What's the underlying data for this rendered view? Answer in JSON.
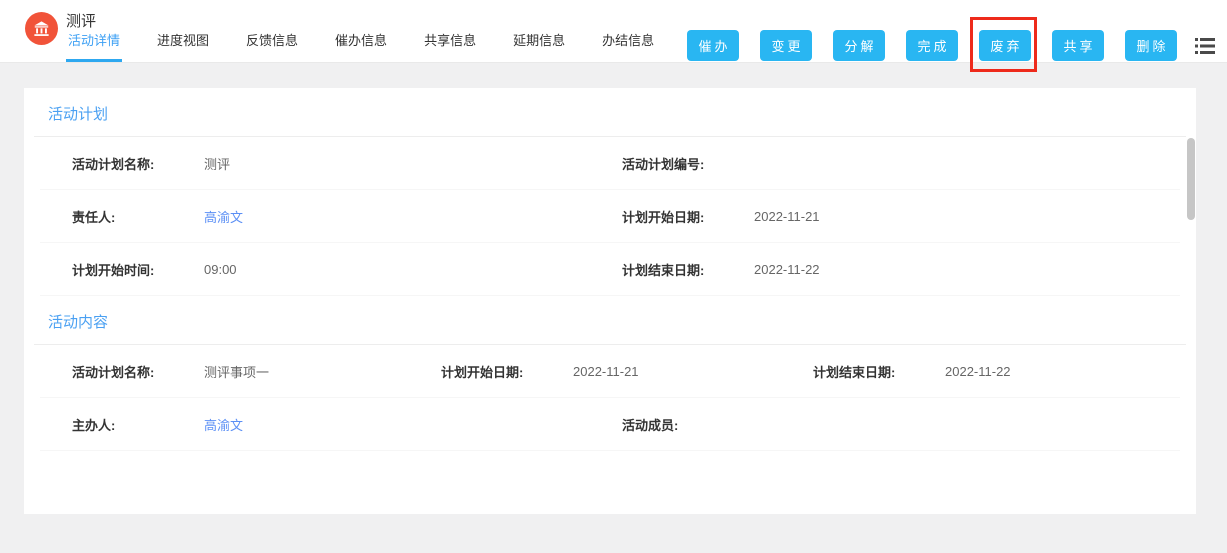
{
  "colors": {
    "button_accent": "#29b6f2",
    "tab_active": "#3da0f4",
    "section_title": "#4aa0f2",
    "person_link": "#5b8ff5",
    "logo_background": "#f15339",
    "annotation_red": "#ee2a1b"
  },
  "header": {
    "title": "测评",
    "tabs": [
      {
        "label": "活动详情",
        "active": true
      },
      {
        "label": "进度视图",
        "active": false
      },
      {
        "label": "反馈信息",
        "active": false
      },
      {
        "label": "催办信息",
        "active": false
      },
      {
        "label": "共享信息",
        "active": false
      },
      {
        "label": "延期信息",
        "active": false
      },
      {
        "label": "办结信息",
        "active": false
      }
    ],
    "actions": [
      {
        "label": "催办"
      },
      {
        "label": "变更"
      },
      {
        "label": "分解"
      },
      {
        "label": "完成"
      },
      {
        "label": "废弃",
        "annotated": true
      },
      {
        "label": "共享"
      },
      {
        "label": "删除"
      }
    ]
  },
  "sections": [
    {
      "title": "活动计划",
      "rows": [
        [
          {
            "label": "活动计划名称:",
            "value": "测评"
          },
          {
            "label": "活动计划编号:",
            "value": ""
          }
        ],
        [
          {
            "label": "责任人:",
            "value": "高渝文",
            "link": true
          },
          {
            "label": "计划开始日期:",
            "value": "2022-11-21"
          }
        ],
        [
          {
            "label": "计划开始时间:",
            "value": "09:00"
          },
          {
            "label": "计划结束日期:",
            "value": "2022-11-22"
          }
        ]
      ]
    },
    {
      "title": "活动内容",
      "rows": [
        [
          {
            "label": "活动计划名称:",
            "value": "测评事项一"
          },
          {
            "label": "计划开始日期:",
            "value": "2022-11-21"
          },
          {
            "label": "计划结束日期:",
            "value": "2022-11-22"
          }
        ],
        [
          {
            "label": "主办人:",
            "value": "高渝文",
            "link": true
          },
          {
            "label": "活动成员:",
            "value": ""
          }
        ]
      ]
    }
  ]
}
